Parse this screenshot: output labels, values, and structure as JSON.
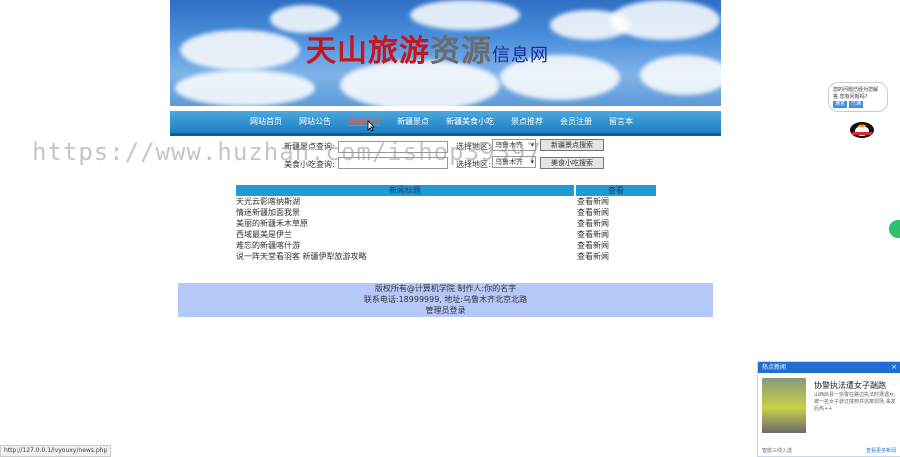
{
  "banner": {
    "title_red": "天山旅游",
    "title_gray": "资源",
    "title_blue": "信息网"
  },
  "nav": {
    "items": [
      "网站首页",
      "网站公告",
      "新疆景点",
      "新疆景点",
      "新疆美食小吃",
      "景点推荐",
      "会员注册",
      "留言本"
    ]
  },
  "search": {
    "spot_label": "新疆景点查询:",
    "spot_value": "",
    "food_label": "美食小吃查询:",
    "food_value": "",
    "region_label1": "选择地区:",
    "region_label2": "选择地区:",
    "region_value1": "乌鲁木齐",
    "region_value2": "乌鲁木齐",
    "spot_button": "新疆景点搜索",
    "food_button": "美食小吃搜索"
  },
  "watermark": "https://www.huzhan.com/ishop39397",
  "table": {
    "headers": [
      "新闻标题",
      "查看"
    ],
    "rows": [
      {
        "title": "天光云影喀纳斯湖",
        "view": "查看新闻"
      },
      {
        "title": "情迷新疆加面我景",
        "view": "查看新闻"
      },
      {
        "title": "美丽的新疆禾木草原",
        "view": "查看新闻"
      },
      {
        "title": "西域最美是伊兰",
        "view": "查看新闻"
      },
      {
        "title": "难忘的新疆喀什游",
        "view": "查看新闻"
      },
      {
        "title": "说一阵天堂看羽客 新疆伊犁旅游攻略",
        "view": "查看新闻"
      }
    ]
  },
  "footer": {
    "line1": "版权所有@计算机学院 制作人:你的名字",
    "line2": "联系电话:18999999, 地址:乌鲁木齐北京北路",
    "admin_link": "管理员登录"
  },
  "status_url": "http://127.0.0.1/lvyouxy/news.php",
  "chat": {
    "text": "您的问题已经为您解答,您有问题吗?",
    "btn1": "满意",
    "btn2": "已满"
  },
  "popup": {
    "header": "热点新闻",
    "close": "×",
    "title": "协警执法遭女子踹跑",
    "text": "山西启县一协警在路边执法时遭遇女,被一名女子驶过撞到并逃离现场,事发后热++",
    "foot_left": "智能三线入选",
    "foot_right": "查看更多新闻"
  }
}
